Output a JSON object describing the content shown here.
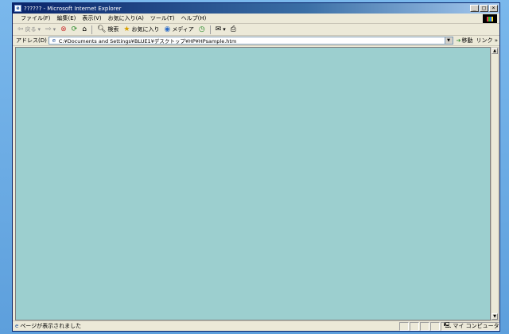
{
  "window": {
    "title": "?????? - Microsoft Internet Explorer",
    "minimize_glyph": "_",
    "maximize_glyph": "□",
    "close_glyph": "×"
  },
  "menu": {
    "items": [
      {
        "label": "ファイル(F)"
      },
      {
        "label": "編集(E)"
      },
      {
        "label": "表示(V)"
      },
      {
        "label": "お気に入り(A)"
      },
      {
        "label": "ツール(T)"
      },
      {
        "label": "ヘルプ(H)"
      }
    ]
  },
  "toolbar": {
    "back_label": "戻る",
    "search_label": "検索",
    "favorites_label": "お気に入り",
    "media_label": "メディア"
  },
  "address": {
    "label": "アドレス(D)",
    "value": "C:¥Documents and Settings¥BLUE1¥デスクトップ¥HP¥HPsample.htm",
    "go_label": "移動",
    "links_label": "リンク »"
  },
  "status": {
    "text": "ページが表示されました",
    "zone": "マイ コンピュータ"
  },
  "colors": {
    "content_bg": "#9ccfcf",
    "title_gradient_start": "#0a246a",
    "desktop": "#6aaee8"
  }
}
